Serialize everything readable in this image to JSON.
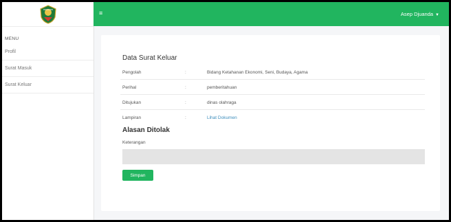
{
  "sidebar": {
    "logo_icon": "west-java-emblem-icon",
    "menu_title": "MENU",
    "items": [
      {
        "label": "Profil"
      },
      {
        "label": "Surat Masuk"
      },
      {
        "label": "Surat Keluar"
      }
    ]
  },
  "topbar": {
    "menu_icon": "hamburger-icon",
    "menu_glyph": "≡",
    "user_name": "Asep Djuanda",
    "user_caret": "▼"
  },
  "detail": {
    "title": "Data Surat Keluar",
    "rows": [
      {
        "label": "Pengolah",
        "sep": ":",
        "value": "Bidang Ketahanan Ekonomi, Seni, Budaya, Agama"
      },
      {
        "label": "Perihal",
        "sep": ":",
        "value": "pemberitahuan"
      },
      {
        "label": "Ditujukan",
        "sep": ":",
        "value": "dinas olahraga"
      },
      {
        "label": "Lampiran",
        "sep": ":",
        "value": "Lihat Dokumen"
      }
    ]
  },
  "rejection": {
    "title": "Alasan Ditolak",
    "field_label": "Keterangan",
    "field_value": "",
    "save_label": "Simpan"
  },
  "colors": {
    "accent": "#21b55f",
    "link": "#3c8dbc"
  }
}
